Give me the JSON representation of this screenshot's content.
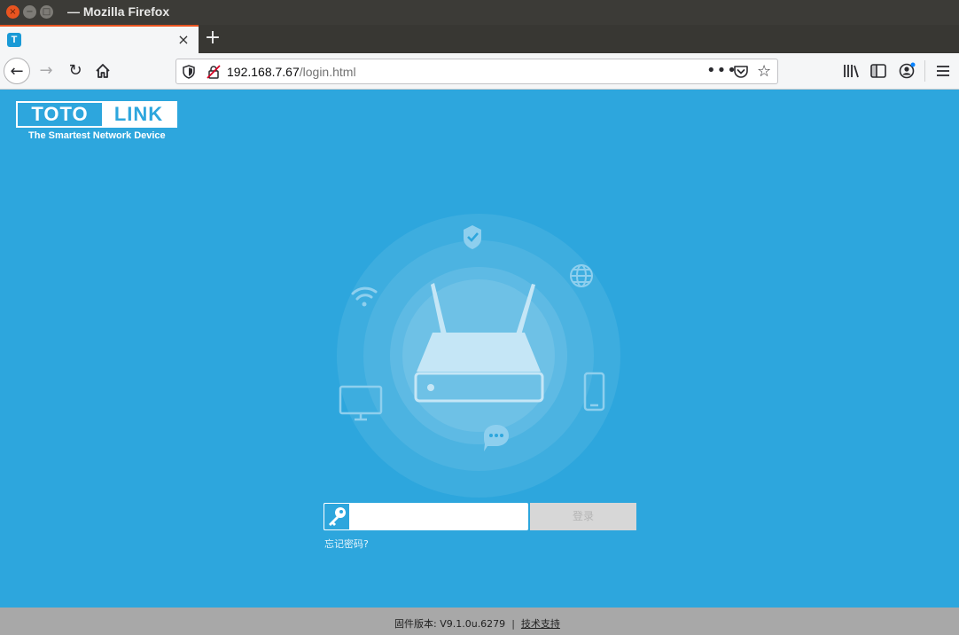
{
  "window": {
    "title": "— Mozilla Firefox",
    "controls": {
      "close_glyph": "×",
      "minimize_glyph": "−",
      "maximize_glyph": "□"
    }
  },
  "tab": {
    "favicon_letter": "T",
    "close_glyph": "×",
    "new_tab_glyph": "+"
  },
  "navbar": {
    "back_glyph": "←",
    "forward_glyph": "→",
    "reload_glyph": "↻",
    "url_host": "192.168.7.67",
    "url_path": "/login.html",
    "page_actions_glyph": "•••",
    "bookmark_glyph": "☆",
    "icons": [
      "shield-icon",
      "insecure-lock-icon",
      "pocket-icon",
      "library-icon",
      "sidebar-icon",
      "account-icon",
      "hamburger-menu-icon"
    ]
  },
  "page": {
    "logo_left": "TOTO",
    "logo_right": "LINK",
    "slogan": "The Smartest Network Device",
    "password": {
      "value": "",
      "placeholder": ""
    },
    "login_label": "登录",
    "forgot_label": "忘记密码?",
    "hero_icons": [
      "shield-check-icon",
      "globe-icon",
      "wifi-icon",
      "router-icon",
      "monitor-icon",
      "phone-icon",
      "chat-icon"
    ]
  },
  "footer": {
    "firmware_label": "固件版本: V9.1.0u.6279",
    "separator": "|",
    "support_label": "技术支持"
  },
  "colors": {
    "page_bg": "#2da6dd",
    "accent": "#e95420",
    "footer_bg": "#a8a8a8"
  }
}
